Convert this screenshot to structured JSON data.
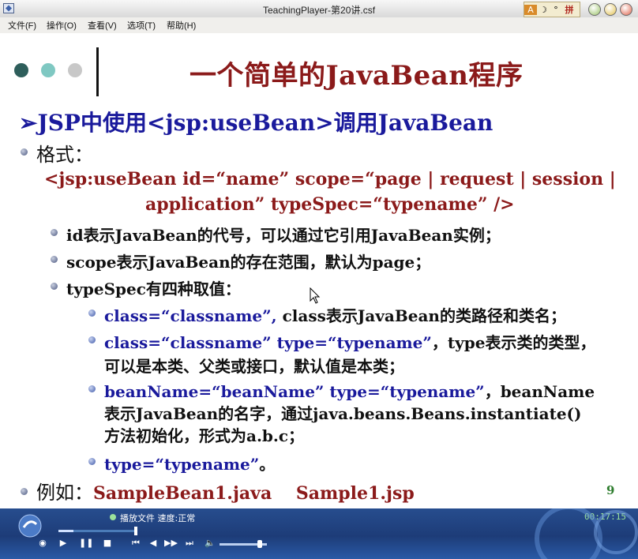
{
  "window": {
    "title": "TeachingPlayer-第20讲.csf",
    "ime_labels": [
      "A",
      "☽",
      "°",
      "拼"
    ]
  },
  "menu": {
    "items": [
      "文件(F)",
      "操作(O)",
      "查看(V)",
      "选项(T)",
      "帮助(H)"
    ]
  },
  "slide": {
    "title": "一个简单的JavaBean程序",
    "heading": "➢JSP中使用<jsp:useBean>调用JavaBean",
    "format_label": "格式：",
    "syntax_line1": "<jsp:useBean id=“name” scope=“page | request | session |",
    "syntax_line2": "application” typeSpec=“typename” />",
    "bullets": [
      "id表示JavaBean的代号，可以通过它引用JavaBean实例；",
      "scope表示JavaBean的存在范围，默认为page；",
      "typeSpec有四种取值："
    ],
    "sub1": {
      "code": "class=“classname”,",
      "text": " class表示JavaBean的类路径和类名；"
    },
    "sub2": {
      "code": "class=“classname” type=“typename”",
      "text": "，type表示类的类型，",
      "line2": "可以是本类、父类或接口，默认值是本类；"
    },
    "sub3": {
      "code": "beanName=“beanName” type=“typename”",
      "text": "，beanName",
      "line2": "表示JavaBean的名字，通过java.beans.Beans.instantiate()",
      "line3": "方法初始化，形式为a.b.c；"
    },
    "sub4": {
      "code": "type=“typename”",
      "text": "。"
    },
    "example_label": "例如：",
    "example_files": "SampleBean1.java    Sample1.jsp",
    "page_number": "9",
    "colors": {
      "title": "#8b1a1a",
      "blue": "#1a1a9c",
      "dot1": "#2e5e5b",
      "dot2": "#7fc8c2",
      "dot3": "#c8c8c8"
    }
  },
  "player": {
    "status": "播放文件 速度:正常",
    "time": "00:17:15",
    "progress_fraction": 0.2,
    "volume_fraction": 0.85
  }
}
